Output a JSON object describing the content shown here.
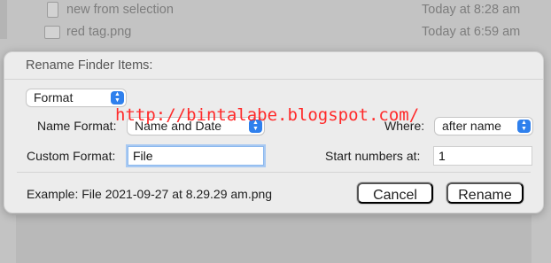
{
  "background_files": [
    {
      "name": "new from selection",
      "date": "Today at 8:28 am",
      "icon": "document-icon"
    },
    {
      "name": "red tag.png",
      "date": "Today at 6:59 am",
      "icon": "image-file-icon"
    }
  ],
  "dialog": {
    "title": "Rename Finder Items:",
    "mode_popup": "Format",
    "name_format_label": "Name Format:",
    "name_format_value": "Name and Date",
    "where_label": "Where:",
    "where_value": "after name",
    "custom_format_label": "Custom Format:",
    "custom_format_value": "File",
    "start_numbers_label": "Start numbers at:",
    "start_numbers_value": "1",
    "example_text": "Example: File 2021-09-27 at 8.29.29 am.png",
    "cancel_label": "Cancel",
    "rename_label": "Rename"
  },
  "watermark": "http://bintalabe.blogspot.com/",
  "colors": {
    "accent": "#2f80ed",
    "focus_ring": "#a8c9f2",
    "watermark": "#ff2a2a"
  }
}
